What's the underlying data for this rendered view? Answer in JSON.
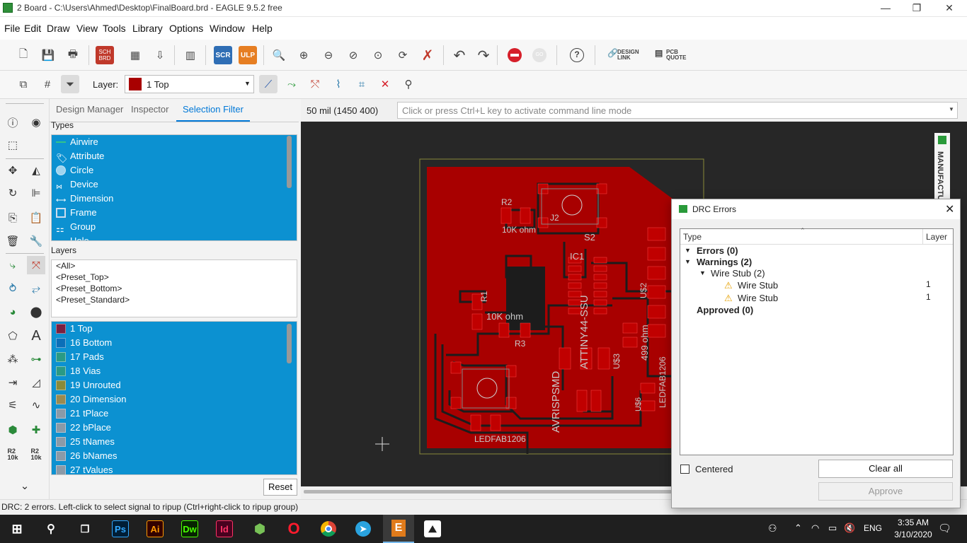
{
  "window": {
    "title": "2 Board - C:\\Users\\Ahmed\\Desktop\\FinalBoard.brd - EAGLE 9.5.2 free",
    "minimize": "—",
    "restore": "❐",
    "close": "✕"
  },
  "menu": [
    "File",
    "Edit",
    "Draw",
    "View",
    "Tools",
    "Library",
    "Options",
    "Window",
    "Help"
  ],
  "toolbar": {
    "sch_brd": "SCH BRD",
    "scr": "SCR",
    "ulp": "ULP",
    "go": "GO",
    "help": "?",
    "design_link": "DESIGN LINK",
    "pcb_quote": "PCB QUOTE"
  },
  "layerbar": {
    "label": "Layer:",
    "selected": "1 Top",
    "selected_color": "#a80000"
  },
  "panel": {
    "tabs": [
      "Design Manager",
      "Inspector",
      "Selection Filter"
    ],
    "active_tab": "Selection Filter",
    "types_label": "Types",
    "types": [
      "Airwire",
      "Attribute",
      "Circle",
      "Device",
      "Dimension",
      "Frame",
      "Group",
      "Hole"
    ],
    "layers_label": "Layers",
    "presets": [
      "<All>",
      "<Preset_Top>",
      "<Preset_Bottom>",
      "<Preset_Standard>"
    ],
    "layers": [
      {
        "name": "1 Top",
        "color": "#7a2040"
      },
      {
        "name": "16 Bottom",
        "color": "#0b6fb8"
      },
      {
        "name": "17 Pads",
        "color": "#2a9a84"
      },
      {
        "name": "18 Vias",
        "color": "#2a9a84"
      },
      {
        "name": "19 Unrouted",
        "color": "#8a8a3a"
      },
      {
        "name": "20 Dimension",
        "color": "#9a8a50"
      },
      {
        "name": "21 tPlace",
        "color": "#8a9aa8"
      },
      {
        "name": "22 bPlace",
        "color": "#8a9aa8"
      },
      {
        "name": "25 tNames",
        "color": "#8a9aa8"
      },
      {
        "name": "26 bNames",
        "color": "#8a9aa8"
      },
      {
        "name": "27 tValues",
        "color": "#8a9aa8"
      }
    ],
    "reset": "Reset"
  },
  "coords": "50 mil (1450 400)",
  "command_placeholder": "Click or press Ctrl+L key to activate command line mode",
  "side_label": "MANUFACTU",
  "board_labels": {
    "r2": "R2",
    "r2v": "10K ohm",
    "r1": "R1",
    "r1v": "10K ohm",
    "r3": "R3",
    "ic1": "IC1",
    "ic1v": "ATTINY44-SSU",
    "s2": "S2",
    "j2": "J2",
    "u2": "U$2",
    "ohm499": "499 ohm",
    "avr": "AVRISPSMD",
    "led1": "LEDFAB1206",
    "led2": "LEDFAB1206",
    "us3": "U$3",
    "us6": "U$6"
  },
  "statusbar": "DRC: 2 errors. Left-click to select signal to ripup (Ctrl+right-click to ripup group)",
  "drc": {
    "title": "DRC Errors",
    "col_type": "Type",
    "col_layer": "Layer",
    "errors": "Errors (0)",
    "warnings": "Warnings (2)",
    "wire_stub_group": "Wire Stub (2)",
    "items": [
      {
        "type": "Wire Stub",
        "layer": "1"
      },
      {
        "type": "Wire Stub",
        "layer": "1"
      }
    ],
    "approved": "Approved (0)",
    "centered": "Centered",
    "clear_all": "Clear all",
    "approve": "Approve"
  },
  "taskbar": {
    "apps": [
      "Ps",
      "Ai",
      "Dw",
      "Id"
    ],
    "lang": "ENG",
    "time": "3:35 AM",
    "date": "3/10/2020"
  }
}
